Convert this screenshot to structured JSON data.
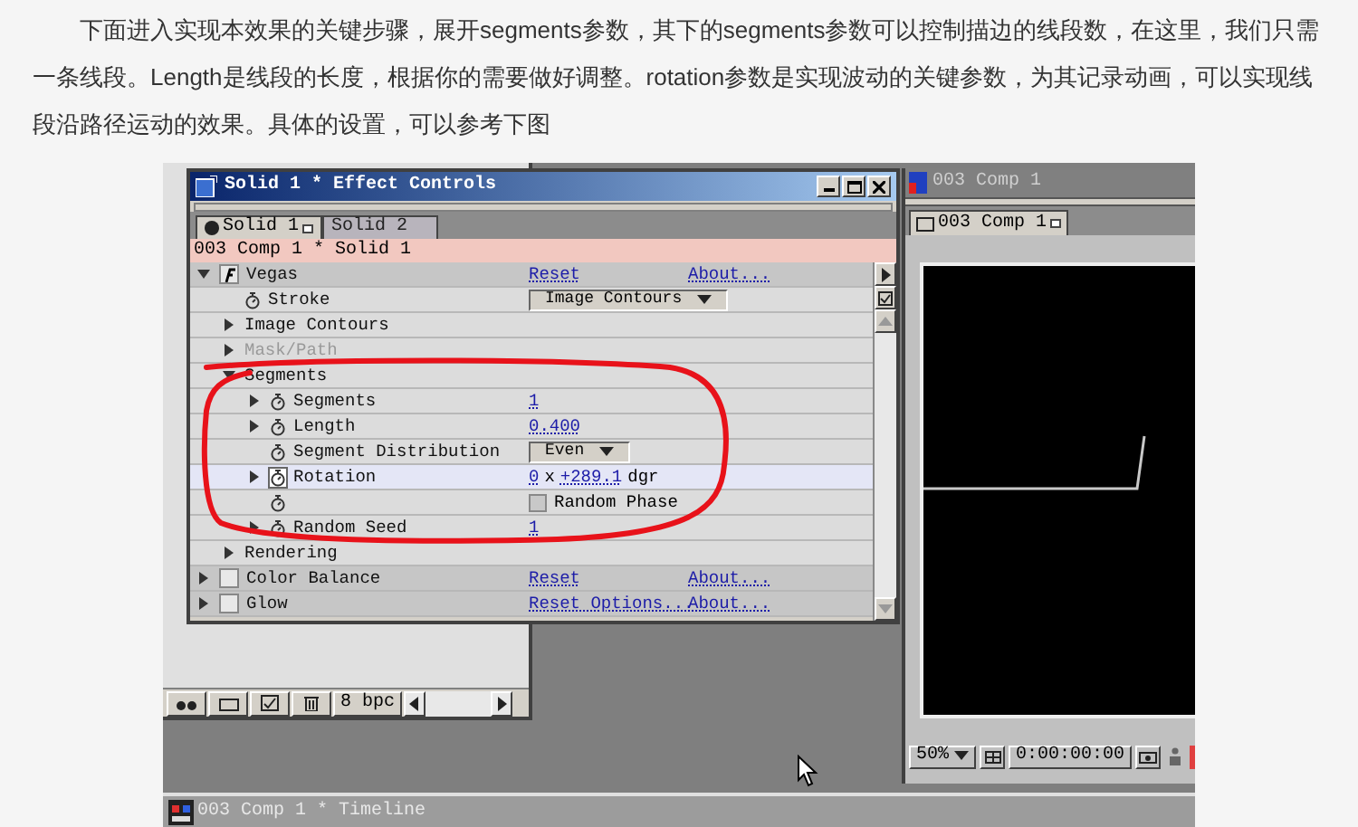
{
  "article": {
    "paragraph": "下面进入实现本效果的关键步骤，展开segments参数，其下的segments参数可以控制描边的线段数，在这里，我们只需一条线段。Length是线段的长度，根据你的需要做好调整。rotation参数是实现波动的关键参数，为其记录动画，可以实现线段沿路径运动的效果。具体的设置，可以参考下图"
  },
  "screenshot": {
    "effect_controls": {
      "title": "Solid 1 * Effect Controls",
      "tabs": [
        {
          "label": "Solid 1",
          "selected": true
        },
        {
          "label": "Solid 2",
          "selected": false
        }
      ],
      "layer_path": "003 Comp 1 * Solid 1",
      "rows": [
        {
          "kind": "effect",
          "label": "Vegas",
          "expanded": true,
          "fx_on": true,
          "selected": false,
          "links": [
            "Reset",
            "About..."
          ],
          "children": [
            {
              "kind": "property",
              "label": "Stroke",
              "keyframed": false,
              "selected": false,
              "value": {
                "kind": "dropdown",
                "text": "Image Contours"
              }
            },
            {
              "kind": "group",
              "label": "Image Contours",
              "expanded": false,
              "disabled": false,
              "selected": false
            },
            {
              "kind": "group",
              "label": "Mask/Path",
              "expanded": false,
              "disabled": true,
              "selected": false
            },
            {
              "kind": "group",
              "label": "Segments",
              "expanded": true,
              "disabled": false,
              "selected": false,
              "children": [
                {
                  "kind": "property",
                  "label": "Segments",
                  "expanded": false,
                  "keyframed": false,
                  "selected": false,
                  "value": {
                    "kind": "number",
                    "text": "1"
                  }
                },
                {
                  "kind": "property",
                  "label": "Length",
                  "expanded": false,
                  "keyframed": false,
                  "selected": false,
                  "value": {
                    "kind": "number",
                    "text": "0.400"
                  }
                },
                {
                  "kind": "property",
                  "label": "Segment Distribution",
                  "keyframed": false,
                  "selected": false,
                  "value": {
                    "kind": "dropdown",
                    "text": "Even"
                  }
                },
                {
                  "kind": "property",
                  "label": "Rotation",
                  "expanded": false,
                  "keyframed": true,
                  "selected": true,
                  "value": {
                    "kind": "angle",
                    "revolutions": "0",
                    "separator": "x",
                    "degrees": "+289.1",
                    "unit": "dgr"
                  }
                },
                {
                  "kind": "property",
                  "keyframed": false,
                  "selected": false,
                  "value": {
                    "kind": "checkbox",
                    "text": "Random Phase",
                    "checked": false
                  }
                },
                {
                  "kind": "property",
                  "label": "Random Seed",
                  "expanded": false,
                  "keyframed": false,
                  "selected": false,
                  "value": {
                    "kind": "number",
                    "text": "1"
                  }
                }
              ]
            },
            {
              "kind": "group",
              "label": "Rendering",
              "expanded": false,
              "disabled": false,
              "selected": false
            }
          ]
        },
        {
          "kind": "effect",
          "label": "Color Balance",
          "expanded": false,
          "fx_on": false,
          "selected": false,
          "links": [
            "Reset",
            "About..."
          ]
        },
        {
          "kind": "effect",
          "label": "Glow",
          "expanded": false,
          "fx_on": false,
          "selected": false,
          "links": [
            "Reset Options...",
            "About..."
          ]
        }
      ]
    },
    "project_toolbar": {
      "bit_depth": "8 bpc"
    },
    "comp_window": {
      "title": "003 Comp 1",
      "tab": "003 Comp 1",
      "zoom": "50%",
      "timecode": "0:00:00:00"
    },
    "timeline": {
      "title": "003 Comp 1 * Timeline"
    }
  }
}
